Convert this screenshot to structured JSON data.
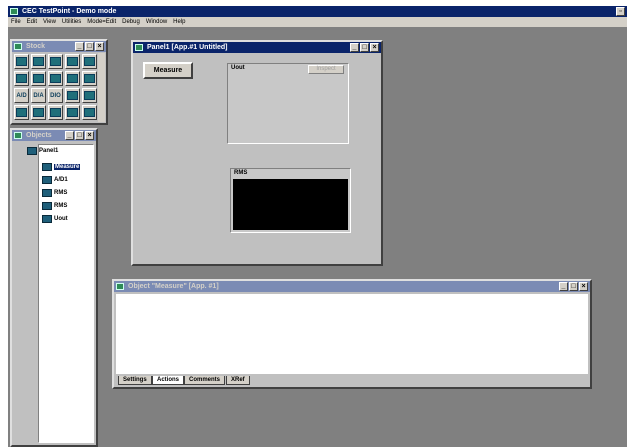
{
  "app": {
    "title": "CEC TestPoint - Demo mode",
    "menu": [
      "File",
      "Edit",
      "View",
      "Utilities",
      "Mode=Edit",
      "Debug",
      "Window",
      "Help"
    ]
  },
  "stock_window": {
    "title": "Stock",
    "tools": [
      {
        "label": "",
        "icon": "display-icon"
      },
      {
        "label": "",
        "icon": "pushbutton-icon"
      },
      {
        "label": "",
        "icon": "switch-icon"
      },
      {
        "label": "",
        "icon": "slider-icon"
      },
      {
        "label": "",
        "icon": "textbox-icon"
      },
      {
        "label": "",
        "icon": "led-icon"
      },
      {
        "label": "",
        "icon": "meter-icon"
      },
      {
        "label": "",
        "icon": "numeric-icon"
      },
      {
        "label": "",
        "icon": "gauge-icon"
      },
      {
        "label": "",
        "icon": "graph-icon"
      },
      {
        "label": "A/D",
        "icon": "ad-icon"
      },
      {
        "label": "D/A",
        "icon": "da-icon"
      },
      {
        "label": "DIO",
        "icon": "dio-icon"
      },
      {
        "label": "",
        "icon": "math-icon"
      },
      {
        "label": "",
        "icon": "scope-icon"
      },
      {
        "label": "",
        "icon": "loop-icon"
      },
      {
        "label": "",
        "icon": "branch-icon"
      },
      {
        "label": "",
        "icon": "table-icon"
      },
      {
        "label": "",
        "icon": "file-icon"
      },
      {
        "label": "",
        "icon": "timer-icon"
      }
    ]
  },
  "objects_window": {
    "title": "Objects",
    "root": "Panel1",
    "items": [
      {
        "label": "Measure",
        "selected": true,
        "icon": "button-object-icon"
      },
      {
        "label": "A/D1",
        "selected": false,
        "icon": "ad-object-icon"
      },
      {
        "label": "RMS",
        "selected": false,
        "icon": "math-object-icon"
      },
      {
        "label": "RMS",
        "selected": false,
        "icon": "display-object-icon"
      },
      {
        "label": "Uout",
        "selected": false,
        "icon": "graph-object-icon"
      }
    ]
  },
  "panel_window": {
    "title": "Panel1 [App.#1 Untitled]",
    "measure_button": "Measure",
    "graph": {
      "label": "Uout",
      "inspect_button": "Inspect"
    },
    "display": {
      "label": "RMS"
    }
  },
  "object_window": {
    "title": "Object \"Measure\" [App. #1]",
    "tabs": [
      "Settings",
      "Actions",
      "Comments",
      "XRef"
    ],
    "active_tab": "Actions"
  },
  "colors": {
    "desktop": "#808080",
    "active_title": "#0a246a",
    "inactive_title": "#7b8bb4",
    "face": "#c0c0c0",
    "selection": "#0a246a"
  }
}
